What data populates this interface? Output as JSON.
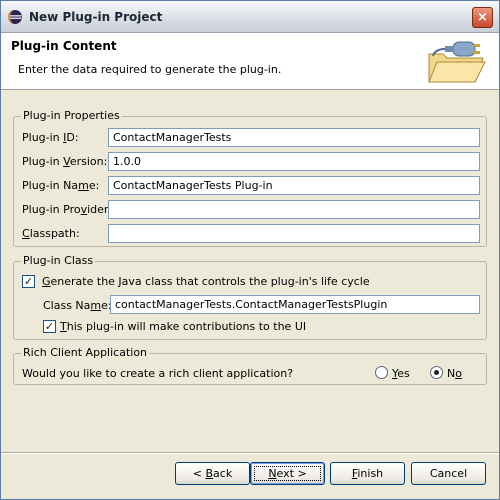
{
  "window": {
    "title": "New Plug-in Project",
    "close_glyph": "×"
  },
  "header": {
    "title": "Plug-in Content",
    "description": "Enter the data required to generate the plug-in.",
    "art_icon": "plug-folder-icon"
  },
  "properties": {
    "legend": "Plug-in Properties",
    "fields": [
      {
        "label_pre": "Plug-in ",
        "label_mn": "I",
        "label_post": "D:",
        "value": "ContactManagerTests"
      },
      {
        "label_pre": "Plug-in ",
        "label_mn": "V",
        "label_post": "ersion:",
        "value": "1.0.0"
      },
      {
        "label_pre": "Plug-in Na",
        "label_mn": "m",
        "label_post": "e:",
        "value": "ContactManagerTests Plug-in"
      },
      {
        "label_pre": "Plug-in Pro",
        "label_mn": "v",
        "label_post": "ider:",
        "value": ""
      },
      {
        "label_pre": "",
        "label_mn": "C",
        "label_post": "lasspath:",
        "value": ""
      }
    ]
  },
  "plugin_class": {
    "legend": "Plug-in Class",
    "generate_label_pre": "",
    "generate_label_mn": "G",
    "generate_label_post": "enerate the Java class that controls the plug-in's life cycle",
    "generate_checked": true,
    "class_name_label_pre": "Class Na",
    "class_name_label_mn": "m",
    "class_name_label_post": "e:",
    "class_name_value": "contactManagerTests.ContactManagerTestsPlugin",
    "ui_label_pre": "",
    "ui_label_mn": "T",
    "ui_label_post": "his plug-in will make contributions to the UI",
    "ui_checked": true
  },
  "rcp": {
    "legend": "Rich Client Application",
    "question": "Would you like to create a rich client application?",
    "yes_mn": "Y",
    "yes_post": "es",
    "no_pre": "N",
    "no_mn": "o",
    "selected": "No"
  },
  "buttons": {
    "back_pre": "< ",
    "back_mn": "B",
    "back_post": "ack",
    "next_mn": "N",
    "next_post": "ext >",
    "finish_mn": "F",
    "finish_post": "inish",
    "cancel": "Cancel"
  }
}
